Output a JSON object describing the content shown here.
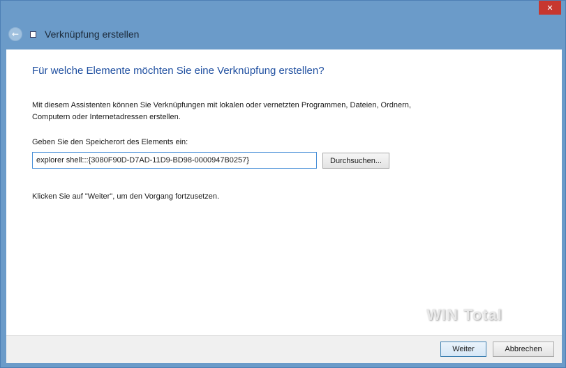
{
  "window": {
    "title": "Verknüpfung erstellen",
    "close_glyph": "✕",
    "back_glyph": "←"
  },
  "content": {
    "heading": "Für welche Elemente möchten Sie eine Verknüpfung erstellen?",
    "description": "Mit diesem Assistenten können Sie Verknüpfungen mit lokalen oder vernetzten Programmen, Dateien, Ordnern, Computern oder Internetadressen erstellen.",
    "location_label": "Geben Sie den Speicherort des Elements ein:",
    "location_value": "explorer shell:::{3080F90D-D7AD-11D9-BD98-0000947B0257}",
    "browse_label": "Durchsuchen...",
    "continue_text": "Klicken Sie auf \"Weiter\", um den Vorgang fortzusetzen."
  },
  "footer": {
    "next_label": "Weiter",
    "cancel_label": "Abbrechen"
  },
  "watermark": "WIN Total",
  "colors": {
    "accent": "#1f4fa0",
    "frame": "#6b9bc9",
    "close": "#c7372f"
  }
}
